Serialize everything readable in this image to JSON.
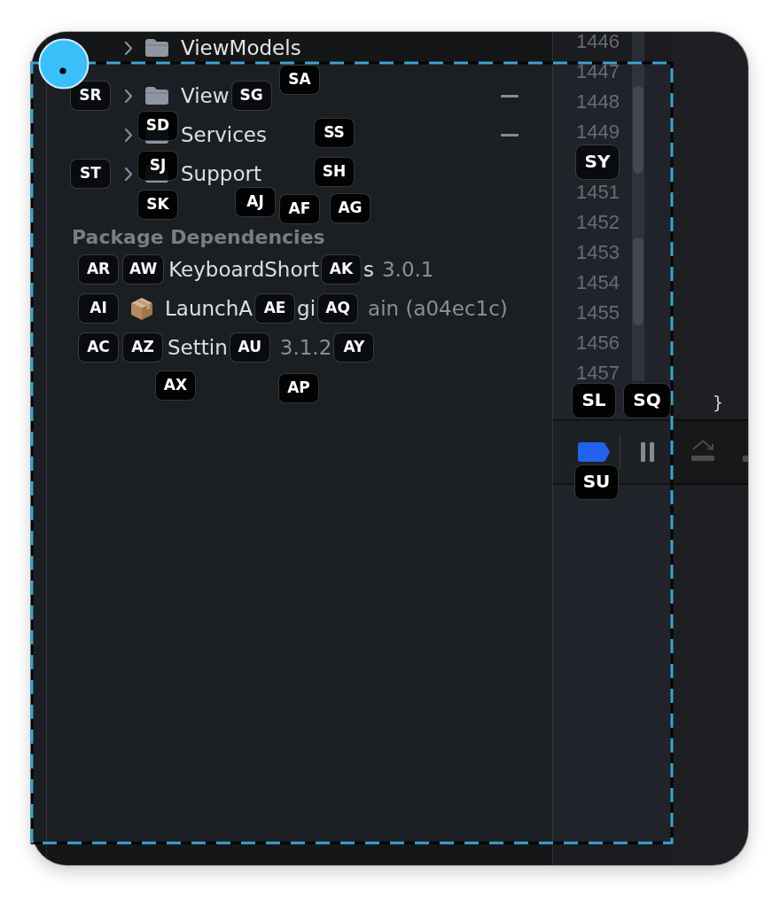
{
  "navigator": {
    "folders": [
      {
        "marked": false,
        "parts": [
          {
            "kind": "chevron",
            "expanded": false
          },
          {
            "kind": "folder"
          },
          {
            "kind": "name",
            "text": "ViewModels"
          }
        ]
      },
      {
        "marked": true,
        "parts": [
          {
            "kind": "hint",
            "text": "SR"
          },
          {
            "kind": "chevron",
            "expanded": false
          },
          {
            "kind": "folder"
          },
          {
            "kind": "name",
            "text": "View"
          },
          {
            "kind": "hint",
            "text": "SG"
          }
        ]
      },
      {
        "marked": true,
        "parts": [
          {
            "kind": "chevron",
            "expanded": false
          },
          {
            "kind": "folder"
          },
          {
            "kind": "name",
            "text": "Services"
          }
        ]
      },
      {
        "marked": false,
        "parts": [
          {
            "kind": "hint",
            "text": "ST"
          },
          {
            "kind": "chevron",
            "expanded": false
          },
          {
            "kind": "folder"
          },
          {
            "kind": "name",
            "text": "Support"
          }
        ]
      }
    ],
    "section_title": "Package Dependencies",
    "packages": [
      {
        "parts": [
          {
            "kind": "hint",
            "text": "AR"
          },
          {
            "kind": "hint",
            "text": "AW"
          },
          {
            "kind": "name",
            "text": "KeyboardShort"
          },
          {
            "kind": "hint",
            "text": "AK"
          },
          {
            "kind": "name",
            "text": "s"
          },
          {
            "kind": "detail",
            "text": "3.0.1"
          }
        ]
      },
      {
        "parts": [
          {
            "kind": "hint",
            "text": "AI"
          },
          {
            "kind": "package_icon"
          },
          {
            "kind": "name",
            "text": "LaunchA"
          },
          {
            "kind": "hint",
            "text": "AE"
          },
          {
            "kind": "name",
            "text": "gi"
          },
          {
            "kind": "hint",
            "text": "AQ"
          },
          {
            "kind": "detail",
            "text": "ain (a04ec1c)"
          }
        ]
      },
      {
        "parts": [
          {
            "kind": "hint",
            "text": "AC"
          },
          {
            "kind": "hint",
            "text": "AZ"
          },
          {
            "kind": "name",
            "text": "Settin"
          },
          {
            "kind": "hint",
            "text": "AU"
          },
          {
            "kind": "detail",
            "text": "3.1.2"
          },
          {
            "kind": "hint",
            "text": "AY"
          }
        ]
      }
    ]
  },
  "editor": {
    "gutter": [
      {
        "kind": "number",
        "text": "1446"
      },
      {
        "kind": "number",
        "text": "1447"
      },
      {
        "kind": "number",
        "text": "1448"
      },
      {
        "kind": "number",
        "text": "1449"
      },
      {
        "kind": "hint",
        "text": "SY"
      },
      {
        "kind": "number",
        "text": "1451"
      },
      {
        "kind": "number",
        "text": "1452"
      },
      {
        "kind": "number",
        "text": "1453"
      },
      {
        "kind": "number",
        "text": "1454"
      },
      {
        "kind": "number",
        "text": "1455"
      },
      {
        "kind": "number",
        "text": "1456"
      },
      {
        "kind": "number",
        "text": "1457"
      }
    ],
    "code": "}"
  },
  "debug_bar": {
    "breakpoints_on": true
  },
  "floating_hints": [
    "SA",
    "SD",
    "SS",
    "SJ",
    "SH",
    "SK",
    "AJ",
    "AF",
    "AG",
    "AX",
    "AP",
    "SL",
    "SQ",
    "SU"
  ]
}
